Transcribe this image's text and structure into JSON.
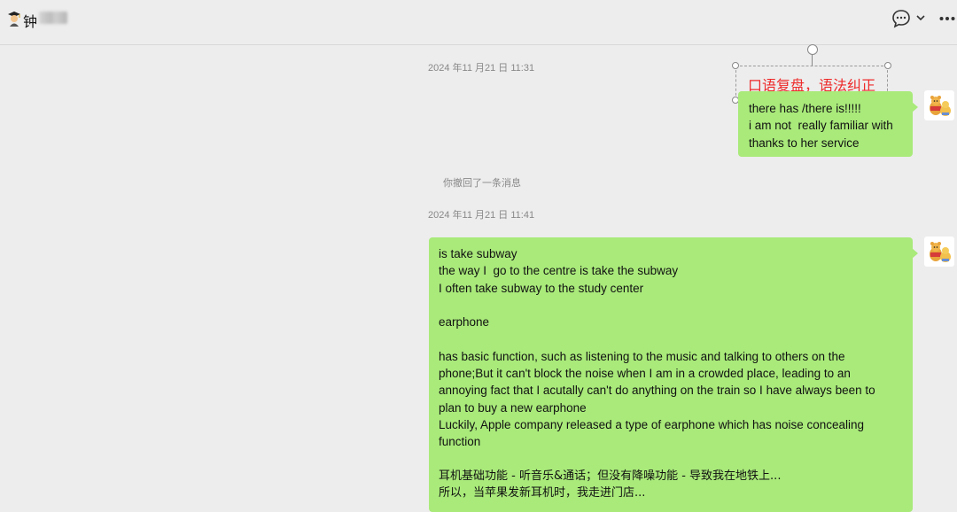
{
  "header": {
    "contact_name": "钟",
    "icons": [
      "graduate-emoji-icon",
      "chat-bubble-icon",
      "chevron-down-icon",
      "more-icon"
    ]
  },
  "messages": {
    "timestamp_1": "2024 年11 月21 日 11:31",
    "bubble_1": {
      "lines": [
        "there has /there is!!!!!",
        "i am not  really familiar with",
        "thanks to her service"
      ]
    },
    "annotation": "口语复盘，语法纠正",
    "system_notice": "你撤回了一条消息",
    "timestamp_2": "2024 年11 月21 日 11:41",
    "bubble_2": {
      "lines": [
        "is take subway",
        "the way I  go to the centre is take the subway",
        "I often take subway to the study center",
        "",
        "earphone",
        "",
        "has basic function, such as listening to the music and talking to others on the",
        "phone;But it can't block the noise when I am in a crowded place, leading to an",
        "annoying fact that I acutally can't do anything on the train so I have always been to",
        "plan to buy a new earphone",
        "Luckily, Apple company released a type of earphone which has noise concealing",
        "function",
        "",
        "耳机基础功能 - 听音乐&通话；但没有降噪功能 - 导致我在地铁上...",
        "所以，当苹果发新耳机时，我走进门店..."
      ]
    }
  },
  "colors": {
    "background": "#ededed",
    "bubble": "#a9ea7a",
    "annotation_text": "#ee2a2a"
  }
}
